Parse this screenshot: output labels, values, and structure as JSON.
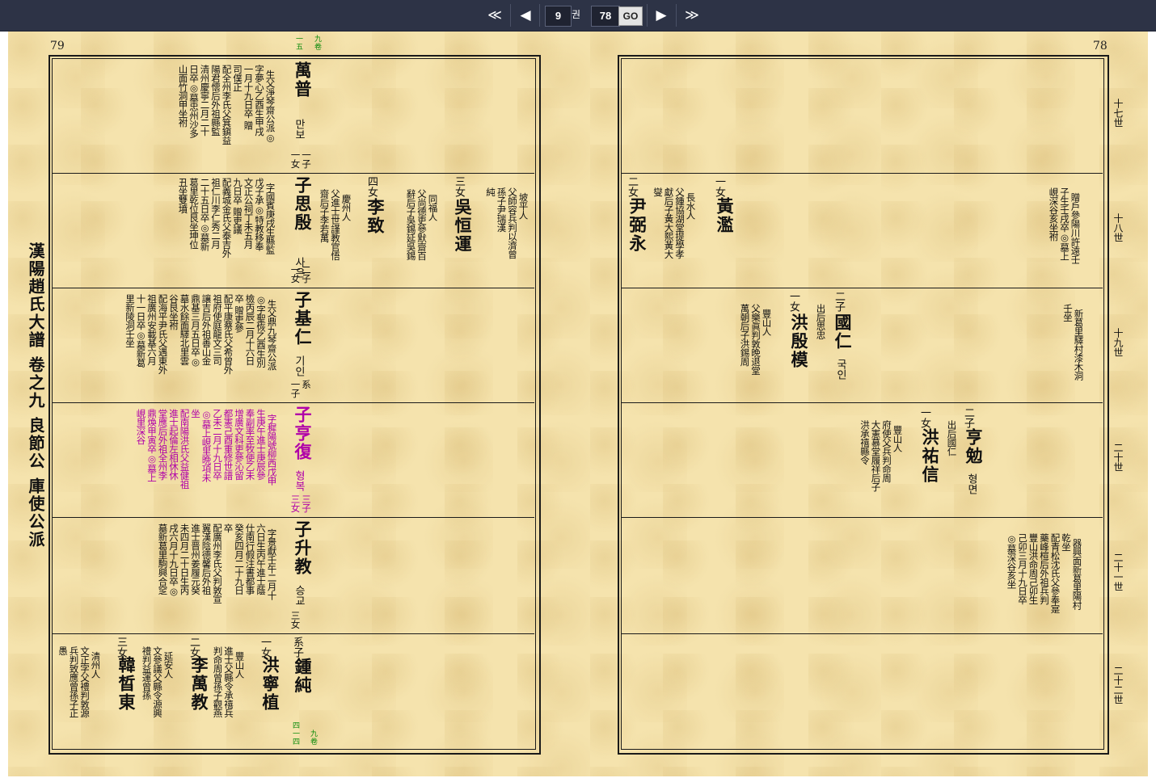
{
  "toolbar": {
    "first_icon": "≪",
    "prev_icon": "◀",
    "volume_value": "9",
    "volume_unit": "권",
    "page_value": "78",
    "go_label": "GO",
    "next_icon": "▶",
    "last_icon": "≫"
  },
  "left_page": {
    "page_number": "79",
    "title": "漢陽趙氏大譜 卷之九 良節公 庫使公派",
    "top_mark": [
      "九",
      "卷",
      "一",
      "五"
    ],
    "bottom_mark": [
      "九",
      "卷",
      "四",
      "一",
      "四"
    ],
    "row1": {
      "name": "萬普",
      "hangul": "만보",
      "relation": "一子\n一女",
      "notes": [
        "生父淨琴齋公派◎",
        "字夢心乙酉生甲戌",
        "一月十九日卒 贈",
        "司僕正",
        "配全州李氏父箕鎭益",
        "陽君懷后外祖縣監",
        "清州慶寧二月二十",
        "日卒◎墓忠州沙多",
        "山面竹洞甲坐祔"
      ]
    },
    "row2": {
      "name": "子思殷",
      "hangul": "사은",
      "relation": "二子\n一女",
      "notes": [
        "字國賓庚戌生縣監",
        "戊子承◎特教移奉",
        "文正公祠丁未五月",
        "九日卒 贈吏議",
        "配義城金氏父泰吉外",
        "祖仁川李仁秀二月",
        "二十五日卒◎墓新",
        "葛里乾位艮坐坤位",
        "丑坐雙墳"
      ],
      "child1_label": "三女",
      "child1_name": "吳恒運",
      "child1_notes": [
        "同福人",
        "父尚德吏參默齋百",
        "辭后子吳錫延吳錫"
      ],
      "child2_label": "四女",
      "child2_name": "李致",
      "child2_notes": [
        "慶州人",
        "父進士世謹教官悟",
        "齋后子李若萬"
      ],
      "extra_notes": [
        "坡平人",
        "父師容兵判以濟曾",
        "孫子尹瑞漢",
        "純"
      ]
    },
    "row3": {
      "name": "子基仁",
      "hangul": "기인",
      "relation": "系\n一子",
      "notes": [
        "生父鼎九琴齋公派",
        "◎字聖恢乙酉生別",
        "檢丙辰二月十六日",
        "卒 贈吏參",
        "配平康蔡氏父希曾外",
        "祖府使庭龍文三司",
        "讓吉后外祖善山金",
        "鼎基三月五日卒◎",
        "墓水餘面驛北里雲",
        "谷艮坐祔",
        "配海平尹氏父遇東外",
        "祖廣州安載基六月",
        "十一日卒◎墓新葛",
        "里新陵洞壬坐"
      ]
    },
    "row4": {
      "name": "子亨復",
      "hangul": "형복",
      "relation": "三子\n三女",
      "notes": [
        "字穉陽號柳西戊申",
        "生庚午進士庚辰參",
        "奉副率至牧使乙未",
        "增廣文科吏參沁留",
        "都憲己酉重修世譜",
        "乙未二月十九日卒",
        "◎墓上峴里晩項未",
        "坐",
        "配南陽洪氏父益健祖",
        "進士起倫左相休休",
        "堂應后外祖全州李",
        "鼎煥甲寅卒◎墓上",
        "峴里深谷"
      ]
    },
    "row5": {
      "name": "子升教",
      "hangul": "승교",
      "relation": "三女",
      "notes": [
        "字景獻壬午二月十",
        "六日生丙午進士蔭",
        "仕南行假注書都事",
        "癸亥四月二十九日",
        "卒",
        "配廣州李氏父判敦宣",
        "翼漢陰德馨后外祖",
        "進士晋州姜履元癸",
        "未四月二十日生丙",
        "戌六月十九日卒◎",
        "墓新葛里駒興合窆"
      ]
    },
    "row6": {
      "name": "鍾純",
      "relation": "系子",
      "child1_label": "一女",
      "child1_name": "洪寧植",
      "child1_notes": [
        "豐山人",
        "進士父縣令承禧兵",
        "判命周曾孫子觀燕"
      ],
      "child2_label": "二女",
      "child2_name": "李萬教",
      "child2_notes": [
        "延安人",
        "文參議父縣令源興",
        "禮判益運曾孫"
      ],
      "child3_label": "三女",
      "child3_name": "韓晳東",
      "child3_notes": [
        "清州人",
        "文正字父禮判敦源",
        "兵判致應曾孫子正",
        "愚"
      ]
    }
  },
  "right_page": {
    "page_number": "78",
    "generations": [
      "十七世",
      "十八世",
      "十九世",
      "二十世",
      "二十一世",
      "二十二世"
    ],
    "row1": {
      "notes": [
        "贈戶參陽川許遠壬",
        "子生壬戌卒◎墓上",
        "峴深谷亥坐祔"
      ]
    },
    "row2": {
      "child1_label": "一女",
      "child1_name": "黃濫",
      "child1_notes": [
        "長水人",
        "父鍾協湖堂提學孝",
        "獻后子黃大熙黃大",
        "燮"
      ],
      "child2_label": "二女",
      "child2_name": "尹弼永"
    },
    "row3": {
      "notes": [
        "新葛里驛村漆木洞",
        "壬坐"
      ],
      "child1_label": "二子",
      "child1_name": "國仁",
      "child1_hangul": "국인",
      "child1_notes": [
        "出后思忠"
      ],
      "child2_label": "一女",
      "child2_name": "洪殷模",
      "child2_notes": [
        "豐山人",
        "父樂眞判敦晩退堂",
        "萬朝后子洪錫周"
      ]
    },
    "row4": {
      "child1_label": "二子",
      "child1_name": "亨勉",
      "child1_hangul": "형면",
      "child1_notes": [
        "出后國仁"
      ],
      "child2_label": "一女",
      "child2_name": "洪祐信",
      "child2_notes": [
        "豐山人",
        "府使父兵判命周",
        "大憲慕堂履祥后子",
        "洪承禧縣令"
      ]
    },
    "row5": {
      "notes": [
        "器興面新葛里陽村",
        "乾坐",
        "配青松沈氏父參奉寔",
        "藥峰楦后外祖兵判",
        "豐山洪命周己卯生",
        "己卯三月十九日卒",
        "◎墓深谷亥坐"
      ]
    }
  }
}
